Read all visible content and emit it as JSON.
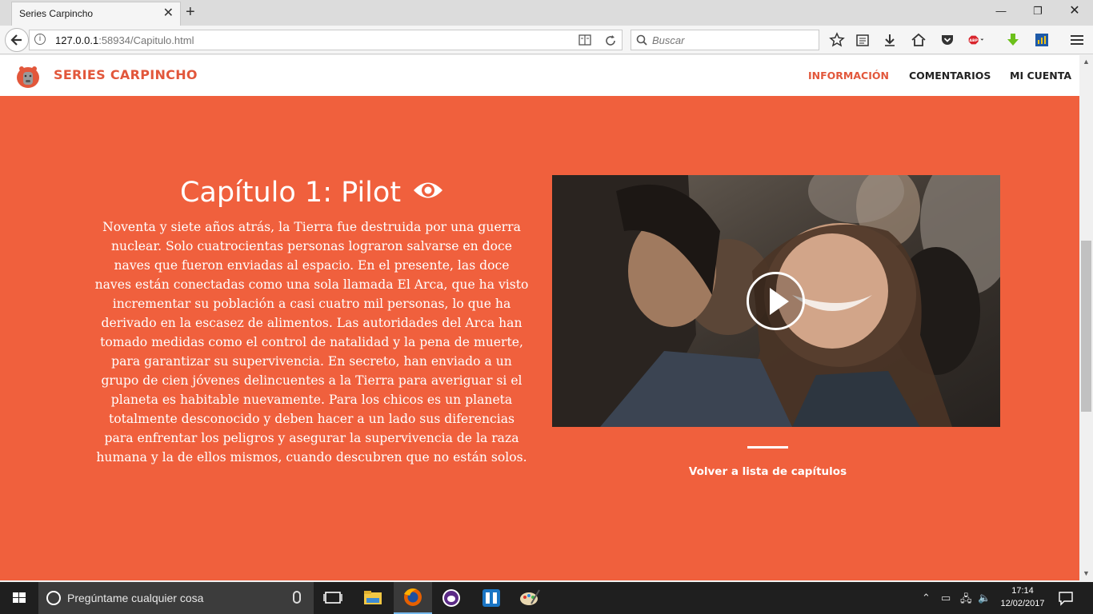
{
  "browser": {
    "tab_title": "Series Carpincho",
    "url_host": "127.0.0.1",
    "url_rest": ":58934/Capitulo.html",
    "search_placeholder": "Buscar",
    "abp_label": "ABP"
  },
  "site": {
    "brand": "SERIES CARPINCHO",
    "menu": [
      {
        "label": "INFORMACIÓN",
        "active": true
      },
      {
        "label": "COMENTARIOS",
        "active": false
      },
      {
        "label": "MI CUENTA",
        "active": false
      }
    ],
    "accent_color": "#f0603d"
  },
  "chapter": {
    "title": "Capítulo 1: Pilot",
    "synopsis": "Noventa y siete años atrás, la Tierra fue destruida por una guerra nuclear. Solo cuatrocientas personas lograron salvarse en doce naves que fueron enviadas al espacio. En el presente, las doce naves están conectadas como una sola llamada El Arca, que ha visto incrementar su población a casi cuatro mil personas, lo que ha derivado en la escasez de alimentos. Las autoridades del Arca han tomado medidas como el control de natalidad y la pena de muerte, para garantizar su supervivencia. En secreto, han enviado a un grupo de cien jóvenes delincuentes a la Tierra para averiguar si el planeta es habitable nuevamente. Para los chicos es un planeta totalmente desconocido y deben hacer a un lado sus diferencias para enfrentar los peligros y asegurar la supervivencia de la raza humana y la de ellos mismos, cuando descubren que no están solos.",
    "back_link": "Volver a lista de capítulos"
  },
  "taskbar": {
    "search_placeholder": "Pregúntame cualquier cosa",
    "time": "17:14",
    "date": "12/02/2017"
  }
}
